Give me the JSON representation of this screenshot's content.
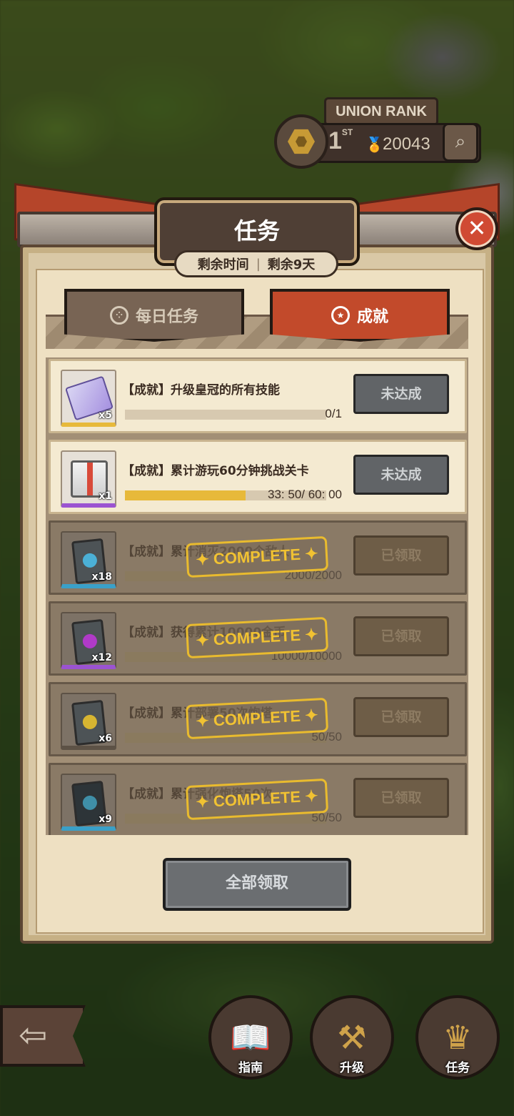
{
  "union_rank": {
    "title": "UNION RANK",
    "place": "1",
    "place_suffix": "ST",
    "score": "20043"
  },
  "panel": {
    "title": "任务",
    "time_label": "剩余时间",
    "time_value": "剩余9天"
  },
  "tabs": [
    {
      "label": "每日任务",
      "active": false
    },
    {
      "label": "成就",
      "active": true
    }
  ],
  "tasks": [
    {
      "title": "【成就】升级皇冠的所有技能",
      "progress": "0/1",
      "fraction": 0.0,
      "button": "未达成",
      "qty": "x5",
      "done": false
    },
    {
      "title": "【成就】累计游玩60分钟挑战关卡",
      "progress": "33: 50/ 60: 00",
      "fraction": 0.6,
      "button": "未达成",
      "qty": "x1",
      "done": false
    },
    {
      "title": "【成就】累计消灭2000个敌人",
      "progress": "2000/2000",
      "fraction": 1.0,
      "button": "已领取",
      "qty": "x18",
      "done": true,
      "stamp": "✦ COMPLETE ✦"
    },
    {
      "title": "【成就】获得累计10000金币",
      "progress": "10000/10000",
      "fraction": 1.0,
      "button": "已领取",
      "qty": "x12",
      "done": true,
      "stamp": "✦ COMPLETE ✦"
    },
    {
      "title": "【成就】累计部署50次炮塔",
      "progress": "50/50",
      "fraction": 1.0,
      "button": "已领取",
      "qty": "x6",
      "done": true,
      "stamp": "✦ COMPLETE ✦"
    },
    {
      "title": "【成就】累计强化炮塔50次",
      "progress": "50/50",
      "fraction": 1.0,
      "button": "已领取",
      "qty": "x9",
      "done": true,
      "stamp": "✦ COMPLETE ✦"
    }
  ],
  "claim_all_label": "全部领取",
  "nav": [
    {
      "label": "指南",
      "icon": "book-icon"
    },
    {
      "label": "升级",
      "icon": "hammer-icon"
    },
    {
      "label": "任务",
      "icon": "crown-scroll-icon"
    }
  ],
  "colors": {
    "accent": "#c24a2b",
    "progress": "#e7b93a",
    "stamp": "#f1c232"
  }
}
